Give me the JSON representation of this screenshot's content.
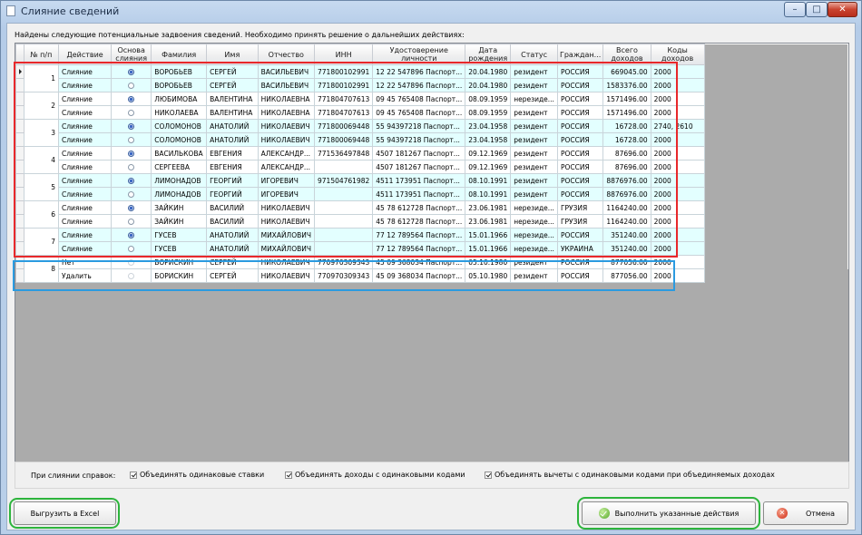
{
  "window": {
    "title": "Слияние сведений",
    "controls": {
      "minimize": "–",
      "maximize": "□",
      "close": "✕"
    }
  },
  "info_text": "Найдены следующие потенциальные задвоения сведений. Необходимо принять решение о дальнейших действиях:",
  "columns": [
    "№ п/п",
    "Действие",
    "Основа слияния",
    "Фамилия",
    "Имя",
    "Отчество",
    "ИНН",
    "Удостоверение личности",
    "Дата рождения",
    "Статус",
    "Граждан...",
    "Всего доходов",
    "Коды доходов"
  ],
  "groups": [
    {
      "num": "1",
      "rows": [
        {
          "action": "Слияние",
          "base": true,
          "last": "ВОРОБЬЕВ",
          "first": "СЕРГЕЙ",
          "middle": "ВАСИЛЬЕВИЧ",
          "inn": "771800102991",
          "doc": "12 22 547896 Паспорт...",
          "dob": "20.04.1980",
          "status": "резидент",
          "citizen": "РОССИЯ",
          "income": "669045.00",
          "codes": "2000"
        },
        {
          "action": "Слияние",
          "base": false,
          "last": "ВОРОБЬЕВ",
          "first": "СЕРГЕЙ",
          "middle": "ВАСИЛЬЕВИЧ",
          "inn": "771800102991",
          "doc": "12 22 547896 Паспорт...",
          "dob": "20.04.1980",
          "status": "резидент",
          "citizen": "РОССИЯ",
          "income": "1583376.00",
          "codes": "2000"
        }
      ]
    },
    {
      "num": "2",
      "rows": [
        {
          "action": "Слияние",
          "base": true,
          "last": "ЛЮБИМОВА",
          "first": "ВАЛЕНТИНА",
          "middle": "НИКОЛАЕВНА",
          "inn": "771804707613",
          "doc": "09 45 765408 Паспорт...",
          "dob": "08.09.1959",
          "status": "нерезиде...",
          "citizen": "РОССИЯ",
          "income": "1571496.00",
          "codes": "2000"
        },
        {
          "action": "Слияние",
          "base": false,
          "last": "НИКОЛАЕВА",
          "first": "ВАЛЕНТИНА",
          "middle": "НИКОЛАЕВНА",
          "inn": "771804707613",
          "doc": "09 45 765408 Паспорт...",
          "dob": "08.09.1959",
          "status": "резидент",
          "citizen": "РОССИЯ",
          "income": "1571496.00",
          "codes": "2000"
        }
      ]
    },
    {
      "num": "3",
      "rows": [
        {
          "action": "Слияние",
          "base": true,
          "last": "СОЛОМОНОВ",
          "first": "АНАТОЛИЙ",
          "middle": "НИКОЛАЕВИЧ",
          "inn": "771800069448",
          "doc": "55 94397218 Паспорт...",
          "dob": "23.04.1958",
          "status": "резидент",
          "citizen": "РОССИЯ",
          "income": "16728.00",
          "codes": "2740, 2610"
        },
        {
          "action": "Слияние",
          "base": false,
          "last": "СОЛОМОНОВ",
          "first": "АНАТОЛИЙ",
          "middle": "НИКОЛАЕВИЧ",
          "inn": "771800069448",
          "doc": "55 94397218 Паспорт...",
          "dob": "23.04.1958",
          "status": "резидент",
          "citizen": "РОССИЯ",
          "income": "16728.00",
          "codes": "2000"
        }
      ]
    },
    {
      "num": "4",
      "rows": [
        {
          "action": "Слияние",
          "base": true,
          "last": "ВАСИЛЬКОВА",
          "first": "ЕВГЕНИЯ",
          "middle": "АЛЕКСАНДР...",
          "inn": "771536497848",
          "doc": "4507 181267 Паспорт...",
          "dob": "09.12.1969",
          "status": "резидент",
          "citizen": "РОССИЯ",
          "income": "87696.00",
          "codes": "2000"
        },
        {
          "action": "Слияние",
          "base": false,
          "last": "СЕРГЕЕВА",
          "first": "ЕВГЕНИЯ",
          "middle": "АЛЕКСАНДР...",
          "inn": "",
          "doc": "4507 181267 Паспорт...",
          "dob": "09.12.1969",
          "status": "резидент",
          "citizen": "РОССИЯ",
          "income": "87696.00",
          "codes": "2000"
        }
      ]
    },
    {
      "num": "5",
      "rows": [
        {
          "action": "Слияние",
          "base": true,
          "last": "ЛИМОНАДОВ",
          "first": "ГЕОРГИЙ",
          "middle": "ИГОРЕВИЧ",
          "inn": "971504761982",
          "doc": "4511 173951 Паспорт...",
          "dob": "08.10.1991",
          "status": "резидент",
          "citizen": "РОССИЯ",
          "income": "8876976.00",
          "codes": "2000"
        },
        {
          "action": "Слияние",
          "base": false,
          "last": "ЛИМОНАДОВ",
          "first": "ГЕОРГИЙ",
          "middle": "ИГОРЕВИЧ",
          "inn": "",
          "doc": "4511 173951 Паспорт...",
          "dob": "08.10.1991",
          "status": "резидент",
          "citizen": "РОССИЯ",
          "income": "8876976.00",
          "codes": "2000"
        }
      ]
    },
    {
      "num": "6",
      "rows": [
        {
          "action": "Слияние",
          "base": true,
          "last": "ЗАЙКИН",
          "first": "ВАСИЛИЙ",
          "middle": "НИКОЛАЕВИЧ",
          "inn": "",
          "doc": "45 78 612728 Паспорт...",
          "dob": "23.06.1981",
          "status": "нерезиде...",
          "citizen": "ГРУЗИЯ",
          "income": "1164240.00",
          "codes": "2000"
        },
        {
          "action": "Слияние",
          "base": false,
          "last": "ЗАЙКИН",
          "first": "ВАСИЛИЙ",
          "middle": "НИКОЛАЕВИЧ",
          "inn": "",
          "doc": "45 78 612728 Паспорт...",
          "dob": "23.06.1981",
          "status": "нерезиде...",
          "citizen": "ГРУЗИЯ",
          "income": "1164240.00",
          "codes": "2000"
        }
      ]
    },
    {
      "num": "7",
      "rows": [
        {
          "action": "Слияние",
          "base": true,
          "last": "ГУСЕВ",
          "first": "АНАТОЛИЙ",
          "middle": "МИХАЙЛОВИЧ",
          "inn": "",
          "doc": "77 12 789564 Паспорт...",
          "dob": "15.01.1966",
          "status": "нерезиде...",
          "citizen": "РОССИЯ",
          "income": "351240.00",
          "codes": "2000"
        },
        {
          "action": "Слияние",
          "base": false,
          "last": "ГУСЕВ",
          "first": "АНАТОЛИЙ",
          "middle": "МИХАЙЛОВИЧ",
          "inn": "",
          "doc": "77 12 789564 Паспорт...",
          "dob": "15.01.1966",
          "status": "нерезиде...",
          "citizen": "УКРАИНА",
          "income": "351240.00",
          "codes": "2000"
        }
      ]
    },
    {
      "num": "8",
      "rows": [
        {
          "action": "Нет",
          "base": false,
          "last": "БОРИСКИН",
          "first": "СЕРГЕЙ",
          "middle": "НИКОЛАЕВИЧ",
          "inn": "770970309343",
          "doc": "45 09 368034 Паспорт...",
          "dob": "05.10.1980",
          "status": "резидент",
          "citizen": "РОССИЯ",
          "income": "877056.00",
          "codes": "2000"
        },
        {
          "action": "Удалить",
          "base": false,
          "last": "БОРИСКИН",
          "first": "СЕРГЕЙ",
          "middle": "НИКОЛАЕВИЧ",
          "inn": "770970309343",
          "doc": "45 09 368034 Паспорт...",
          "dob": "05.10.1980",
          "status": "резидент",
          "citizen": "РОССИЯ",
          "income": "877056.00",
          "codes": "2000"
        }
      ]
    }
  ],
  "options": {
    "label": "При слиянии справок:",
    "items": [
      {
        "label": "Объединять одинаковые ставки",
        "checked": true
      },
      {
        "label": "Объединять доходы с одинаковыми кодами",
        "checked": true
      },
      {
        "label": "Объединять вычеты с одинаковыми кодами при объединяемых доходах",
        "checked": true
      }
    ]
  },
  "buttons": {
    "export": "Выгрузить в Excel",
    "execute": "Выполнить указанные действия",
    "cancel": "Отмена"
  },
  "colors": {
    "row_alt": "#e3ffff",
    "highlight_red": "#e8282b",
    "highlight_blue": "#2b9be0",
    "highlight_green": "#2db43c"
  }
}
